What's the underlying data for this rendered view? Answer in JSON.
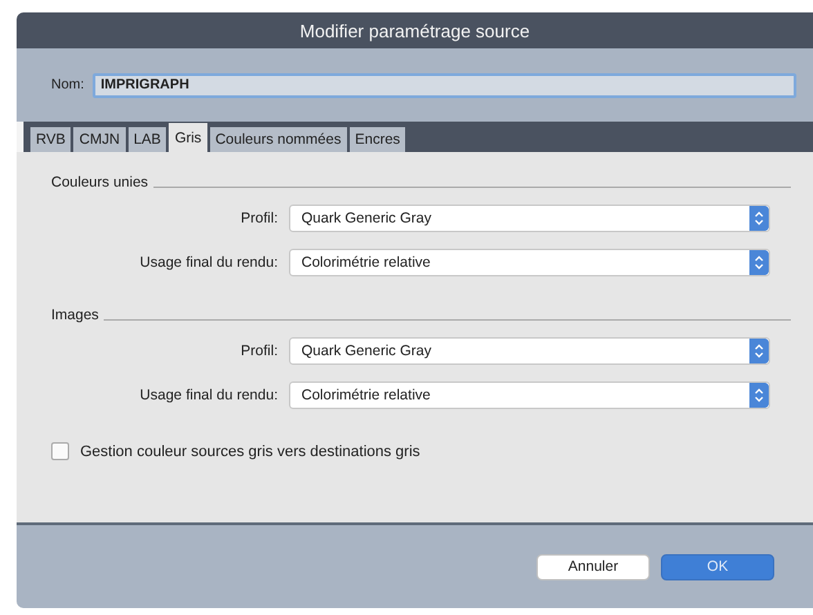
{
  "window": {
    "title": "Modifier paramétrage source"
  },
  "name_field": {
    "label": "Nom:",
    "value": "IMPRIGRAPH"
  },
  "tabs": [
    {
      "label": "RVB",
      "selected": false
    },
    {
      "label": "CMJN",
      "selected": false
    },
    {
      "label": "LAB",
      "selected": false
    },
    {
      "label": "Gris",
      "selected": true
    },
    {
      "label": "Couleurs nommées",
      "selected": false
    },
    {
      "label": "Encres",
      "selected": false
    }
  ],
  "sections": [
    {
      "title": "Couleurs unies",
      "rows": [
        {
          "label": "Profil:",
          "value": "Quark Generic Gray"
        },
        {
          "label": "Usage final du rendu:",
          "value": "Colorimétrie relative"
        }
      ]
    },
    {
      "title": "Images",
      "rows": [
        {
          "label": "Profil:",
          "value": "Quark Generic Gray"
        },
        {
          "label": "Usage final du rendu:",
          "value": "Colorimétrie relative"
        }
      ]
    }
  ],
  "checkbox": {
    "label": "Gestion couleur sources gris vers destinations gris",
    "checked": false
  },
  "buttons": [
    {
      "label": "Annuler",
      "kind": "secondary"
    },
    {
      "label": "OK",
      "kind": "primary"
    }
  ]
}
